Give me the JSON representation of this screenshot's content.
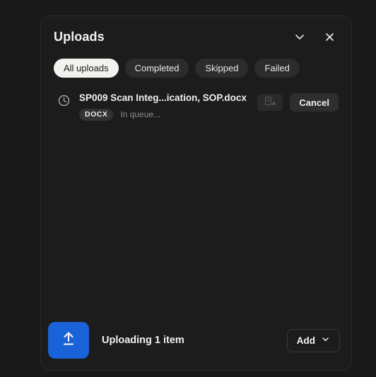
{
  "panel": {
    "title": "Uploads",
    "collapse_icon": "chevron-down-icon",
    "close_icon": "close-icon"
  },
  "filters": [
    {
      "label": "All uploads",
      "active": true
    },
    {
      "label": "Completed",
      "active": false
    },
    {
      "label": "Skipped",
      "active": false
    },
    {
      "label": "Failed",
      "active": false
    }
  ],
  "uploads": [
    {
      "status_icon": "clock-icon",
      "file_name": "SP009 Scan Integ...ication, SOP.docx",
      "type_badge": "DOCX",
      "status_text": "In queue...",
      "preview_icon": "file-preview-icon",
      "cancel_label": "Cancel"
    }
  ],
  "footer": {
    "upload_icon": "upload-arrow-icon",
    "status": "Uploading 1 item",
    "add_label": "Add",
    "add_chevron_icon": "chevron-down-icon"
  },
  "colors": {
    "page_background": "#191919",
    "panel_background": "#1c1c1c",
    "accent_blue": "#1a62d8",
    "chip_active_background": "#f4f2ee",
    "chip_background": "#2c2c2c",
    "muted_text": "#8d8d8d"
  }
}
